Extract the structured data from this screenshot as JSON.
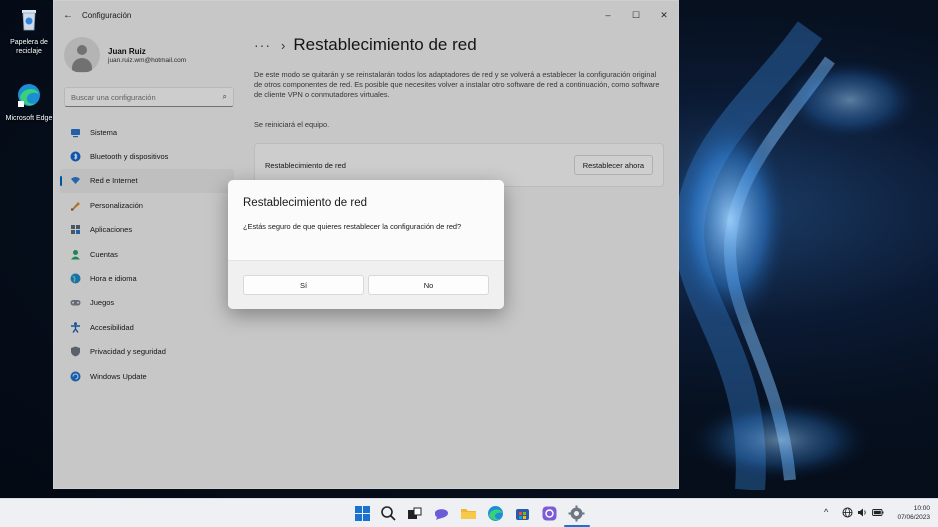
{
  "desktop": {
    "icons": [
      {
        "label": "Papelera de reciclaje",
        "icon": "recycle-bin-icon"
      },
      {
        "label": "Microsoft Edge",
        "icon": "edge-icon"
      }
    ]
  },
  "window": {
    "title": "Configuración",
    "controls": {
      "minimize": "–",
      "maximize": "☐",
      "close": "✕"
    },
    "user": {
      "name": "Juan Ruiz",
      "email": "juan.ruiz.wm@hotmail.com"
    },
    "search": {
      "placeholder": "Buscar una configuración"
    },
    "nav": [
      {
        "label": "Sistema",
        "icon": "system-icon",
        "color": "#2b74c9"
      },
      {
        "label": "Bluetooth y dispositivos",
        "icon": "bluetooth-icon",
        "color": "#0f6ad6"
      },
      {
        "label": "Red e Internet",
        "icon": "network-icon",
        "color": "#2f7ad8",
        "active": true
      },
      {
        "label": "Personalización",
        "icon": "brush-icon",
        "color": "#e08a2a"
      },
      {
        "label": "Aplicaciones",
        "icon": "apps-icon",
        "color": "#5b6a7c"
      },
      {
        "label": "Cuentas",
        "icon": "account-icon",
        "color": "#26a269"
      },
      {
        "label": "Hora e idioma",
        "icon": "globe-clock-icon",
        "color": "#1f8bd0"
      },
      {
        "label": "Juegos",
        "icon": "gamepad-icon",
        "color": "#7d8591"
      },
      {
        "label": "Accesibilidad",
        "icon": "accessibility-icon",
        "color": "#1d63b8"
      },
      {
        "label": "Privacidad y seguridad",
        "icon": "shield-icon",
        "color": "#6f7782"
      },
      {
        "label": "Windows Update",
        "icon": "update-icon",
        "color": "#1a73d1"
      }
    ],
    "breadcrumb": {
      "more": "···",
      "separator": "›",
      "title": "Restablecimiento de red"
    },
    "description": "De este modo se quitarán y se reinstalarán todos los adaptadores de red y se volverá a establecer la configuración original de otros componentes de red. Es posible que necesites volver a instalar otro software de red a continuación, como software de cliente VPN o conmutadores virtuales.",
    "restart_note": "Se reiniciará el equipo.",
    "card": {
      "label": "Restablecimiento de red",
      "button": "Restablecer ahora"
    }
  },
  "dialog": {
    "title": "Restablecimiento de red",
    "message": "¿Estás seguro de que quieres restablecer la configuración de red?",
    "yes": "Sí",
    "no": "No"
  },
  "taskbar": {
    "apps": [
      "start-icon",
      "search-icon",
      "task-view-icon",
      "chat-icon",
      "file-explorer-icon",
      "edge-icon",
      "store-icon",
      "teams-icon",
      "settings-icon"
    ],
    "tray": {
      "chevron": "^",
      "time": "10:00",
      "date": "07/06/2023"
    }
  }
}
